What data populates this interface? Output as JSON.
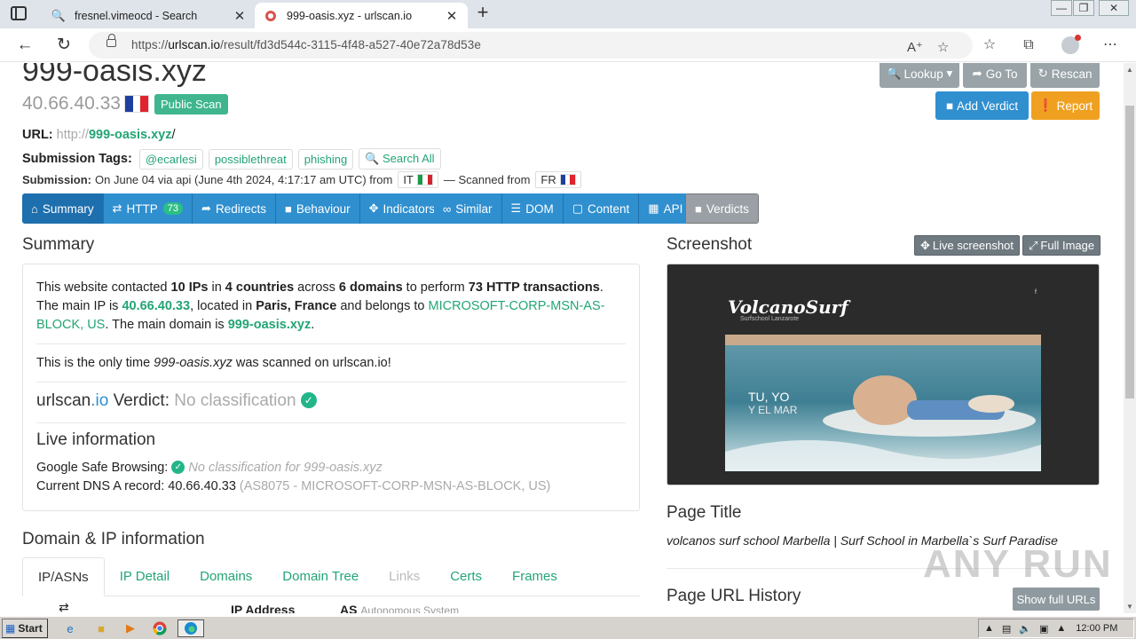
{
  "browser": {
    "tabs": [
      {
        "title": "fresnel.vimeocd - Search",
        "active": false
      },
      {
        "title": "999-oasis.xyz - urlscan.io",
        "active": true
      }
    ],
    "url_prefix": "https://",
    "url_host": "urlscan.io",
    "url_path": "/result/fd3d544c-3115-4f48-a527-40e72a78d53e"
  },
  "result": {
    "domain": "999-oasis.xyz",
    "ip": "40.66.40.33",
    "public_badge": "Public Scan",
    "url_label": "URL:",
    "url_scheme": "http://",
    "url_domain": "999-oasis.xyz",
    "url_tail": "/",
    "tags_label": "Submission Tags:",
    "tags": [
      "@ecarlesi",
      "possiblethreat",
      "phishing"
    ],
    "search_all": "Search All",
    "submission_label": "Submission:",
    "submission_text": "On June 04 via api (June 4th 2024, 4:17:17 am UTC) from",
    "from_cc": "IT",
    "scanned_from_text": "— Scanned from",
    "scanned_cc": "FR"
  },
  "top_buttons": {
    "lookup": "Lookup",
    "goto": "Go To",
    "rescan": "Rescan",
    "add_verdict": "Add Verdict",
    "report": "Report"
  },
  "nav": {
    "summary": "Summary",
    "http": "HTTP",
    "http_count": "73",
    "redirects": "Redirects",
    "behaviour": "Behaviour",
    "indicators": "Indicators",
    "similar": "Similar",
    "dom": "DOM",
    "content": "Content",
    "api": "API",
    "verdicts": "Verdicts"
  },
  "summary": {
    "title": "Summary",
    "p1_a": "This website contacted ",
    "p1_ips": "10 IPs",
    "p1_b": " in ",
    "p1_countries": "4 countries",
    "p1_c": " across ",
    "p1_domains": "6 domains",
    "p1_d": " to perform ",
    "p1_http": "73 HTTP transactions",
    "p1_e": ". The main IP is ",
    "p1_ip": "40.66.40.33",
    "p1_f": ", located in ",
    "p1_loc": "Paris, France",
    "p1_g": " and belongs to ",
    "p1_as": "MICROSOFT-CORP-MSN-AS-BLOCK, US",
    "p1_h": ". The main domain is ",
    "p1_dom": "999-oasis.xyz",
    "p1_i": ".",
    "p2_a": "This is the only time ",
    "p2_dom": "999-oasis.xyz",
    "p2_b": " was scanned on urlscan.io!",
    "verdict_brand": "urlscan",
    "verdict_tld": ".io",
    "verdict_label": " Verdict: ",
    "verdict_value": "No classification",
    "live_title": "Live information",
    "gsb_label": "Google Safe Browsing: ",
    "gsb_value": "No classification for ",
    "gsb_dom": "999-oasis.xyz",
    "dns_label": "Current DNS A record: 40.66.40.33 ",
    "dns_as": "(AS8075 - MICROSOFT-CORP-MSN-AS-BLOCK, US)"
  },
  "domain_ip": {
    "title": "Domain & IP information",
    "tabs": [
      "IP/ASNs",
      "IP Detail",
      "Domains",
      "Domain Tree",
      "Links",
      "Certs",
      "Frames"
    ],
    "col_ip": "IP Address",
    "col_as": "AS",
    "col_as_sub": "Autonomous System"
  },
  "screenshot": {
    "title": "Screenshot",
    "live_btn": "Live screenshot",
    "full_btn": "Full Image",
    "site_logo": "VolcanoSurf",
    "site_sub": "Surfschool Lanzarote",
    "hero_line1": "TU, YO",
    "hero_line2": "Y EL MAR"
  },
  "page_title": {
    "title": "Page Title",
    "value": "volcanos surf school Marbella | Surf School in Marbella`s Surf Paradise"
  },
  "url_history": {
    "title": "Page URL History",
    "button": "Show full URLs"
  },
  "watermark": "ANY RUN",
  "taskbar": {
    "start": "Start",
    "clock": "12:00 PM"
  }
}
